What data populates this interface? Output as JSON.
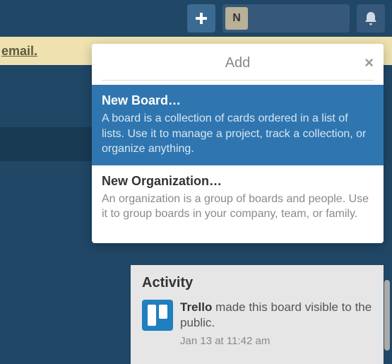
{
  "topbar": {
    "avatar_initial": "N"
  },
  "banner": {
    "link_text": "email."
  },
  "popover": {
    "title": "Add",
    "items": [
      {
        "title": "New Board…",
        "desc": "A board is a collection of cards ordered in a list of lists. Use it to manage a project, track a collection, or organize anything."
      },
      {
        "title": "New Organization…",
        "desc": "An organization is a group of boards and people. Use it to group boards in your company, team, or family."
      }
    ]
  },
  "activity": {
    "heading": "Activity",
    "actor": "Trello",
    "text_rest": " made this board visible to the public.",
    "time": "Jan 13 at 11:42 am"
  }
}
